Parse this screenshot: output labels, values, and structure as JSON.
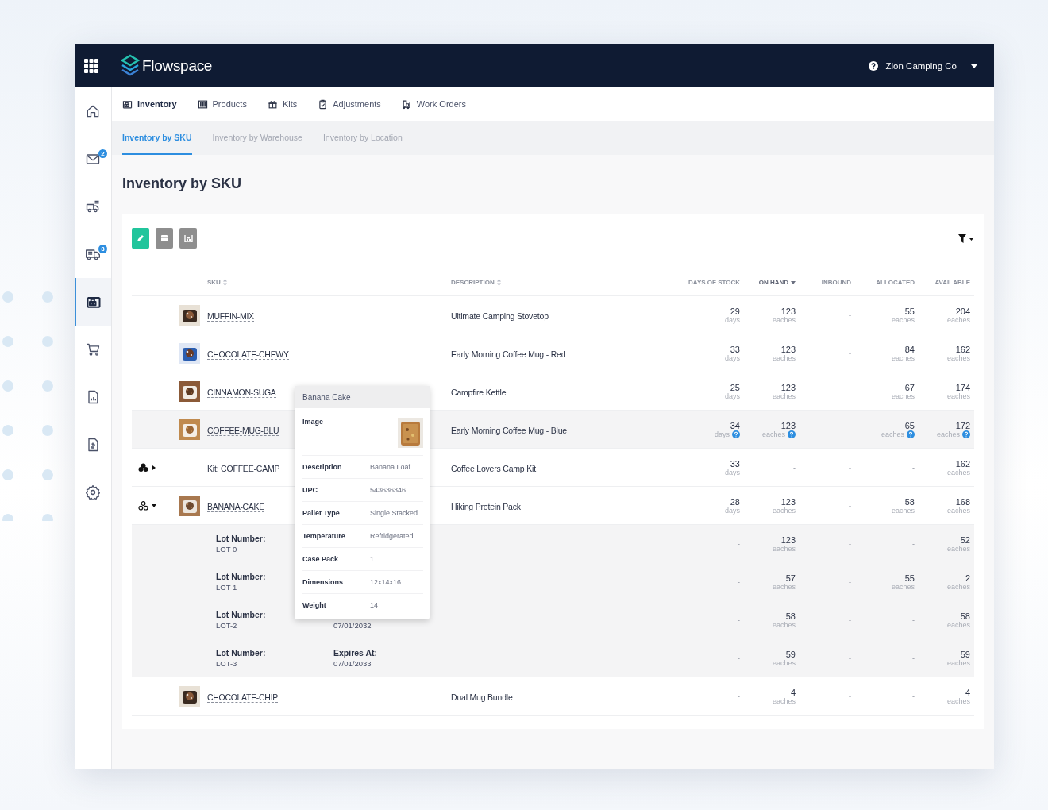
{
  "app": {
    "logo": "Flowspace",
    "account": "Zion Camping Co"
  },
  "sidebar": {
    "items": [
      {
        "selected": false
      },
      {
        "selected": false,
        "badge": "2"
      },
      {
        "selected": false
      },
      {
        "selected": false,
        "badge": "3"
      },
      {
        "selected": true
      },
      {
        "selected": false
      },
      {
        "selected": false
      },
      {
        "selected": false
      },
      {
        "selected": false
      }
    ]
  },
  "nav": {
    "items": [
      {
        "label": "Inventory",
        "selected": true
      },
      {
        "label": "Products",
        "selected": false
      },
      {
        "label": "Kits",
        "selected": false
      },
      {
        "label": "Adjustments",
        "selected": false
      },
      {
        "label": "Work Orders",
        "selected": false
      }
    ]
  },
  "subtabs": [
    {
      "label": "Inventory by SKU",
      "selected": true
    },
    {
      "label": "Inventory by Warehouse",
      "selected": false
    },
    {
      "label": "Inventory by Location",
      "selected": false
    }
  ],
  "page_title": "Inventory by SKU",
  "toolbar": {
    "buttons": [
      {
        "kind": "primary"
      },
      {
        "kind": "secondary"
      },
      {
        "kind": "secondary"
      }
    ]
  },
  "table": {
    "columns": [
      {
        "label": "SKU",
        "sortable": true,
        "sorted": false
      },
      {
        "label": "DESCRIPTION",
        "sortable": true,
        "sorted": false
      },
      {
        "label": "DAYS OF STOCK",
        "sortable": false,
        "sorted": false
      },
      {
        "label": "ON HAND",
        "sortable": true,
        "sorted": true
      },
      {
        "label": "INBOUND",
        "sortable": false,
        "sorted": false
      },
      {
        "label": "ALLOCATED",
        "sortable": false,
        "sorted": false
      },
      {
        "label": "AVAILABLE",
        "sortable": false,
        "sorted": false
      }
    ],
    "rows": [
      {
        "kind": "product",
        "image": {
          "kind": "picture"
        },
        "hovered": false,
        "cells": [
          {
            "kind": "sku",
            "value": "MUFFIN-MIX"
          },
          {
            "kind": "text",
            "value": "Ultimate Camping Stovetop"
          },
          {
            "kind": "quantity",
            "value": "29",
            "unit": "days"
          },
          {
            "kind": "quantity",
            "value": "123",
            "unit": "eaches"
          },
          {
            "kind": "quantity",
            "value": "-"
          },
          {
            "kind": "quantity",
            "value": "55",
            "unit": "eaches"
          },
          {
            "kind": "quantity",
            "value": "204",
            "unit": "eaches"
          }
        ]
      },
      {
        "kind": "product",
        "image": {
          "kind": "picture"
        },
        "hovered": false,
        "cells": [
          {
            "kind": "sku",
            "value": "CHOCOLATE-CHEWY"
          },
          {
            "kind": "text",
            "value": "Early Morning Coffee Mug - Red"
          },
          {
            "kind": "quantity",
            "value": "33",
            "unit": "days"
          },
          {
            "kind": "quantity",
            "value": "123",
            "unit": "eaches"
          },
          {
            "kind": "quantity",
            "value": "-"
          },
          {
            "kind": "quantity",
            "value": "84",
            "unit": "eaches"
          },
          {
            "kind": "quantity",
            "value": "162",
            "unit": "eaches"
          }
        ]
      },
      {
        "kind": "product",
        "image": {
          "kind": "picture"
        },
        "hovered": false,
        "cells": [
          {
            "kind": "sku",
            "value": "CINNAMON-SUGA"
          },
          {
            "kind": "text",
            "value": "Campfire Kettle"
          },
          {
            "kind": "quantity",
            "value": "25",
            "unit": "days"
          },
          {
            "kind": "quantity",
            "value": "123",
            "unit": "eaches"
          },
          {
            "kind": "quantity",
            "value": "-"
          },
          {
            "kind": "quantity",
            "value": "67",
            "unit": "eaches"
          },
          {
            "kind": "quantity",
            "value": "174",
            "unit": "eaches"
          }
        ]
      },
      {
        "kind": "product",
        "image": {
          "kind": "picture"
        },
        "hovered": true,
        "cells": [
          {
            "kind": "sku",
            "value": "COFFEE-MUG-BLU"
          },
          {
            "kind": "text",
            "value": "Early Morning Coffee Mug - Blue"
          },
          {
            "kind": "quantity",
            "value": "34",
            "unit": "days"
          },
          {
            "kind": "quantity",
            "value": "123",
            "unit": "eaches"
          },
          {
            "kind": "quantity",
            "value": "-"
          },
          {
            "kind": "quantity",
            "value": "65",
            "unit": "eaches"
          },
          {
            "kind": "quantity",
            "value": "172",
            "unit": "eaches"
          }
        ]
      },
      {
        "kind": "kit",
        "toggle": {
          "expanded": false
        },
        "hovered": false,
        "cells": [
          {
            "kind": "text",
            "value": "Kit: COFFEE-CAMP"
          },
          {
            "kind": "text",
            "value": "Coffee Lovers Camp Kit"
          },
          {
            "kind": "quantity",
            "value": "33",
            "unit": "days"
          },
          {
            "kind": "quantity",
            "value": "-"
          },
          {
            "kind": "quantity",
            "value": "-"
          },
          {
            "kind": "quantity",
            "value": "-"
          },
          {
            "kind": "quantity",
            "value": "162",
            "unit": "eaches"
          }
        ]
      },
      {
        "kind": "product",
        "toggle": {
          "expanded": true
        },
        "image": {
          "kind": "picture"
        },
        "hovered": false,
        "cells": [
          {
            "kind": "sku",
            "value": "BANANA-CAKE"
          },
          {
            "kind": "text",
            "value": "Hiking Protein Pack"
          },
          {
            "kind": "quantity",
            "value": "28",
            "unit": "days"
          },
          {
            "kind": "quantity",
            "value": "123",
            "unit": "eaches"
          },
          {
            "kind": "quantity",
            "value": "-"
          },
          {
            "kind": "quantity",
            "value": "58",
            "unit": "eaches"
          },
          {
            "kind": "quantity",
            "value": "168",
            "unit": "eaches"
          }
        ],
        "lots": [
          {
            "cells": [
              {
                "kind": "lot",
                "lot_label": "Lot Number:",
                "lot": "LOT-0"
              },
              {
                "kind": "empty"
              },
              {
                "kind": "quantity",
                "value": "-"
              },
              {
                "kind": "quantity",
                "value": "123",
                "unit": "eaches"
              },
              {
                "kind": "quantity",
                "value": "-"
              },
              {
                "kind": "quantity",
                "value": "-"
              },
              {
                "kind": "quantity",
                "value": "52",
                "unit": "eaches"
              }
            ]
          },
          {
            "cells": [
              {
                "kind": "lot",
                "lot_label": "Lot Number:",
                "lot": "LOT-1"
              },
              {
                "kind": "empty"
              },
              {
                "kind": "quantity",
                "value": "-"
              },
              {
                "kind": "quantity",
                "value": "57",
                "unit": "eaches"
              },
              {
                "kind": "quantity",
                "value": "-"
              },
              {
                "kind": "quantity",
                "value": "55",
                "unit": "eaches"
              },
              {
                "kind": "quantity",
                "value": "2",
                "unit": "eaches"
              }
            ]
          },
          {
            "cells": [
              {
                "kind": "lot",
                "lot_label": "Lot Number:",
                "lot": "LOT-2",
                "expires": "07/01/2032"
              },
              {
                "kind": "empty"
              },
              {
                "kind": "quantity",
                "value": "-"
              },
              {
                "kind": "quantity",
                "value": "58",
                "unit": "eaches"
              },
              {
                "kind": "quantity",
                "value": "-"
              },
              {
                "kind": "quantity",
                "value": "-"
              },
              {
                "kind": "quantity",
                "value": "58",
                "unit": "eaches"
              }
            ]
          },
          {
            "cells": [
              {
                "kind": "lot",
                "lot_label": "Lot Number:",
                "lot": "LOT-3",
                "expires_label": "Expires At:",
                "expires": "07/01/2033"
              },
              {
                "kind": "empty"
              },
              {
                "kind": "quantity",
                "value": "-"
              },
              {
                "kind": "quantity",
                "value": "59",
                "unit": "eaches"
              },
              {
                "kind": "quantity",
                "value": "-"
              },
              {
                "kind": "quantity",
                "value": "-"
              },
              {
                "kind": "quantity",
                "value": "59",
                "unit": "eaches"
              }
            ]
          }
        ]
      },
      {
        "kind": "product",
        "image": {
          "kind": "picture"
        },
        "hovered": false,
        "cells": [
          {
            "kind": "sku",
            "value": "CHOCOLATE-CHIP"
          },
          {
            "kind": "text",
            "value": "Dual Mug Bundle"
          },
          {
            "kind": "quantity",
            "value": "-"
          },
          {
            "kind": "quantity",
            "value": "4",
            "unit": "eaches"
          },
          {
            "kind": "quantity",
            "value": "-"
          },
          {
            "kind": "quantity",
            "value": "-"
          },
          {
            "kind": "quantity",
            "value": "4",
            "unit": "eaches"
          }
        ]
      }
    ]
  },
  "tooltip": {
    "title": "Banana Cake",
    "fields": [
      {
        "label": "Image"
      },
      {
        "kind": "text",
        "label": "Description",
        "value": "Banana Loaf"
      },
      {
        "kind": "text",
        "label": "UPC",
        "value": "543636346"
      },
      {
        "kind": "text",
        "label": "Pallet Type",
        "value": "Single Stacked"
      },
      {
        "kind": "text",
        "label": "Temperature",
        "value": "Refridgerated"
      },
      {
        "kind": "text",
        "label": "Case Pack",
        "value": "1"
      },
      {
        "kind": "text",
        "label": "Dimensions",
        "value": "12x14x16"
      },
      {
        "kind": "text",
        "label": "Weight",
        "value": "14"
      }
    ]
  }
}
